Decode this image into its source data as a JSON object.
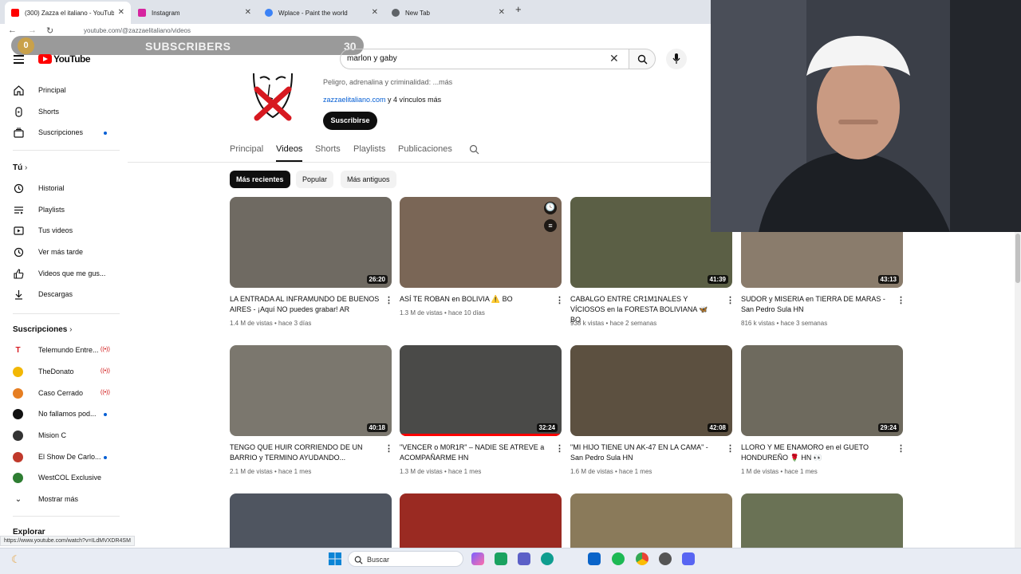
{
  "browser": {
    "tabs": [
      {
        "title": "(300) Zazza el italiano - YouTube",
        "favicon_color": "#ff0000"
      },
      {
        "title": "Instagram",
        "favicon_color": "#d6249f"
      },
      {
        "title": "Wplace - Paint the world",
        "favicon_color": "#3b82f6"
      },
      {
        "title": "New Tab",
        "favicon_color": "#5f6368"
      }
    ],
    "url": "youtube.com/@zazzaelitaliano/videos",
    "status_link": "https://www.youtube.com/watch?v=ILdMVXDR4SM"
  },
  "overlay": {
    "current": "0",
    "label": "SUBSCRIBERS",
    "goal": "30"
  },
  "youtube": {
    "logo_text": "YouTube",
    "search_value": "marlon y gaby"
  },
  "sidebar": {
    "main": [
      {
        "label": "Principal",
        "icon": "home-icon"
      },
      {
        "label": "Shorts",
        "icon": "shorts-icon"
      },
      {
        "label": "Suscripciones",
        "icon": "subscriptions-icon"
      }
    ],
    "you_header": "Tú",
    "you": [
      {
        "label": "Historial",
        "icon": "history-icon"
      },
      {
        "label": "Playlists",
        "icon": "playlist-icon"
      },
      {
        "label": "Tus videos",
        "icon": "your-videos-icon"
      },
      {
        "label": "Ver más tarde",
        "icon": "watch-later-icon"
      },
      {
        "label": "Videos que me gus...",
        "icon": "like-icon"
      },
      {
        "label": "Descargas",
        "icon": "download-icon"
      }
    ],
    "subs_header": "Suscripciones",
    "subs": [
      {
        "label": "Telemundo Entre...",
        "color": "#d71920"
      },
      {
        "label": "TheDonato",
        "color": "#f2b705"
      },
      {
        "label": "Caso Cerrado",
        "color": "#e67e22"
      },
      {
        "label": "No fallamos pod...",
        "color": "#111111"
      },
      {
        "label": "Mision C",
        "color": "#333333"
      },
      {
        "label": "El Show De Carlo...",
        "color": "#c0392b"
      },
      {
        "label": "WestCOL Exclusive",
        "color": "#2e7d32"
      }
    ],
    "show_more": "Mostrar más",
    "explore": "Explorar"
  },
  "channel": {
    "description": "Peligro, adrenalina y criminalidad: ...más",
    "link": "zazzaelitaliano.com",
    "links_more": " y 4 vínculos más",
    "subscribe": "Suscribirse",
    "tabs": [
      "Principal",
      "Videos",
      "Shorts",
      "Playlists",
      "Publicaciones"
    ],
    "chips": [
      "Más recientes",
      "Popular",
      "Más antiguos"
    ]
  },
  "videos": [
    {
      "title": "LA ENTRADA AL INFRAMUNDO DE BUENOS AIRES - ¡Aquí NO puedes grabar! AR",
      "meta": "1.4 M de vistas • hace 3 días",
      "duration": "26:20",
      "bg": "#6f6a62"
    },
    {
      "title": "ASÍ TE ROBAN en BOLIVIA ⚠️ BO",
      "meta": "1.3 M de vistas • hace 10 días",
      "duration": "",
      "bg": "#7a6656"
    },
    {
      "title": "CABALGO ENTRE CR1M1NALES Y VÍCIOSOS en la FORESTA BOLIVIANA 🦋 BO",
      "meta": "938 k vistas • hace 2 semanas",
      "duration": "41:39",
      "bg": "#5b5f45"
    },
    {
      "title": "SUDOR y MISERIA en TIERRA DE MARAS - San Pedro Sula HN",
      "meta": "816 k vistas • hace 3 semanas",
      "duration": "43:13",
      "bg": "#8a7c6c"
    },
    {
      "title": "TENGO QUE HUIR CORRIENDO DE UN BARRIO y TERMINO AYUDANDO...",
      "meta": "2.1 M de vistas • hace 1 mes",
      "duration": "40:18",
      "bg": "#7b776e"
    },
    {
      "title": "\"VENCER o M0R1R\" – NADIE SE ATREVE a ACOMPAÑARME HN",
      "meta": "1.3 M de vistas • hace 1 mes",
      "duration": "32:24",
      "bg": "#4a4a48"
    },
    {
      "title": "\"MI HIJO TIENE UN AK-47 EN LA CAMA\" - San Pedro Sula HN",
      "meta": "1.6 M de vistas • hace 1 mes",
      "duration": "42:08",
      "bg": "#5c5040"
    },
    {
      "title": "LLORO Y ME ENAMORO en el GUETO HONDUREÑO 🌹 HN 👀",
      "meta": "1 M de vistas • hace 1 mes",
      "duration": "29:24",
      "bg": "#6e6a5e"
    },
    {
      "title": "",
      "meta": "",
      "duration": "",
      "bg": "#4f5560"
    },
    {
      "title": "",
      "meta": "",
      "duration": "",
      "bg": "#9a2a22"
    },
    {
      "title": "",
      "meta": "",
      "duration": "",
      "bg": "#8a7a5a"
    },
    {
      "title": "",
      "meta": "",
      "duration": "",
      "bg": "#6a7255"
    }
  ],
  "taskbar": {
    "search_text": "Buscar"
  }
}
